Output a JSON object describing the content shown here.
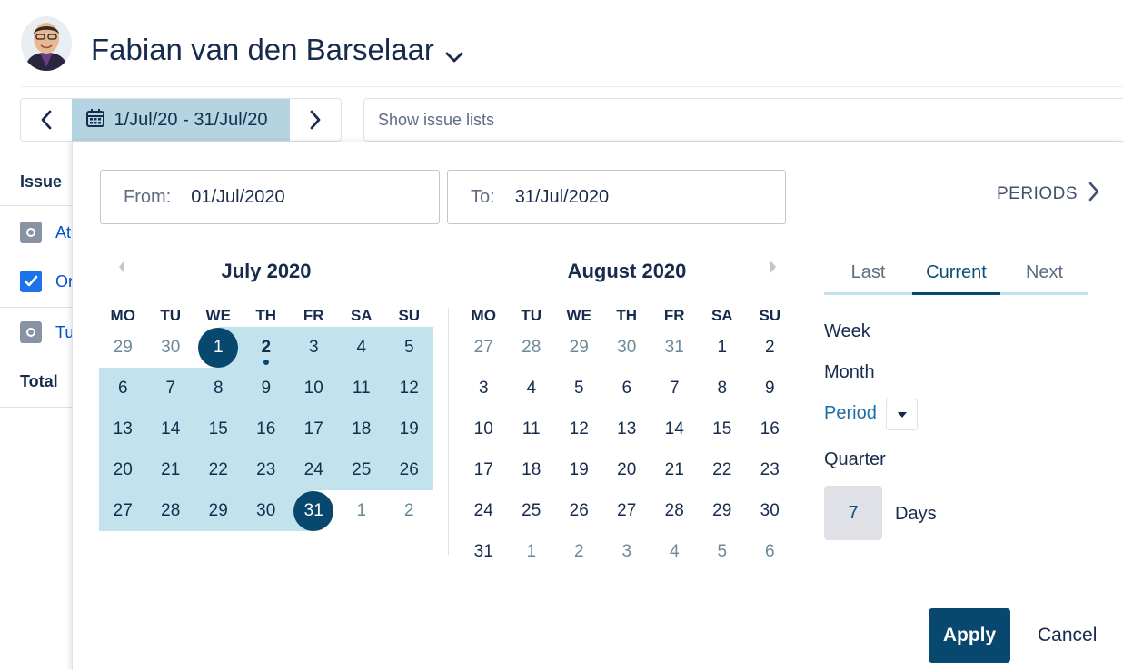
{
  "header": {
    "user_name": "Fabian van den Barselaar"
  },
  "toolbar": {
    "date_range": "1/Jul/20 - 31/Jul/20",
    "issue_lists_placeholder": "Show issue lists"
  },
  "table": {
    "header": "Issue",
    "rows": [
      {
        "label": "At",
        "checked": false
      },
      {
        "label": "Or",
        "checked": true
      },
      {
        "label": "Tu",
        "checked": false
      }
    ],
    "total": "Total"
  },
  "picker": {
    "from_label": "From:",
    "from_value": "01/Jul/2020",
    "to_label": "To:",
    "to_value": "31/Jul/2020",
    "periods_label": "PERIODS",
    "weekdays": [
      "MO",
      "TU",
      "WE",
      "TH",
      "FR",
      "SA",
      "SU"
    ],
    "months": [
      {
        "title": "July 2020",
        "days": [
          {
            "d": "29",
            "other": true
          },
          {
            "d": "30",
            "other": true
          },
          {
            "d": "1",
            "sel": "start"
          },
          {
            "d": "2",
            "range": true,
            "today": true
          },
          {
            "d": "3",
            "range": true
          },
          {
            "d": "4",
            "range": true
          },
          {
            "d": "5",
            "range": true
          },
          {
            "d": "6",
            "range": true
          },
          {
            "d": "7",
            "range": true
          },
          {
            "d": "8",
            "range": true
          },
          {
            "d": "9",
            "range": true
          },
          {
            "d": "10",
            "range": true
          },
          {
            "d": "11",
            "range": true
          },
          {
            "d": "12",
            "range": true
          },
          {
            "d": "13",
            "range": true
          },
          {
            "d": "14",
            "range": true
          },
          {
            "d": "15",
            "range": true
          },
          {
            "d": "16",
            "range": true
          },
          {
            "d": "17",
            "range": true
          },
          {
            "d": "18",
            "range": true
          },
          {
            "d": "19",
            "range": true
          },
          {
            "d": "20",
            "range": true
          },
          {
            "d": "21",
            "range": true
          },
          {
            "d": "22",
            "range": true
          },
          {
            "d": "23",
            "range": true
          },
          {
            "d": "24",
            "range": true
          },
          {
            "d": "25",
            "range": true
          },
          {
            "d": "26",
            "range": true
          },
          {
            "d": "27",
            "range": true
          },
          {
            "d": "28",
            "range": true
          },
          {
            "d": "29",
            "range": true
          },
          {
            "d": "30",
            "range": true
          },
          {
            "d": "31",
            "sel": "end"
          },
          {
            "d": "1",
            "other": true
          },
          {
            "d": "2",
            "other": true
          }
        ]
      },
      {
        "title": "August 2020",
        "days": [
          {
            "d": "27",
            "other": true
          },
          {
            "d": "28",
            "other": true
          },
          {
            "d": "29",
            "other": true
          },
          {
            "d": "30",
            "other": true
          },
          {
            "d": "31",
            "other": true
          },
          {
            "d": "1"
          },
          {
            "d": "2"
          },
          {
            "d": "3"
          },
          {
            "d": "4"
          },
          {
            "d": "5"
          },
          {
            "d": "6"
          },
          {
            "d": "7"
          },
          {
            "d": "8"
          },
          {
            "d": "9"
          },
          {
            "d": "10"
          },
          {
            "d": "11"
          },
          {
            "d": "12"
          },
          {
            "d": "13"
          },
          {
            "d": "14"
          },
          {
            "d": "15"
          },
          {
            "d": "16"
          },
          {
            "d": "17"
          },
          {
            "d": "18"
          },
          {
            "d": "19"
          },
          {
            "d": "20"
          },
          {
            "d": "21"
          },
          {
            "d": "22"
          },
          {
            "d": "23"
          },
          {
            "d": "24"
          },
          {
            "d": "25"
          },
          {
            "d": "26"
          },
          {
            "d": "27"
          },
          {
            "d": "28"
          },
          {
            "d": "29"
          },
          {
            "d": "30"
          },
          {
            "d": "31"
          },
          {
            "d": "1",
            "other": true
          },
          {
            "d": "2",
            "other": true
          },
          {
            "d": "3",
            "other": true
          },
          {
            "d": "4",
            "other": true
          },
          {
            "d": "5",
            "other": true
          },
          {
            "d": "6",
            "other": true
          }
        ]
      }
    ],
    "period_tabs": [
      "Last",
      "Current",
      "Next"
    ],
    "active_tab": "Current",
    "period_options": {
      "week": "Week",
      "month": "Month",
      "period": "Period",
      "quarter": "Quarter"
    },
    "days_value": "7",
    "days_label": "Days",
    "apply_label": "Apply",
    "cancel_label": "Cancel"
  },
  "colors": {
    "primary": "#08476e",
    "range": "#c2e3ee",
    "date_button": "#b3d4e0",
    "link": "#1a6fa1"
  }
}
